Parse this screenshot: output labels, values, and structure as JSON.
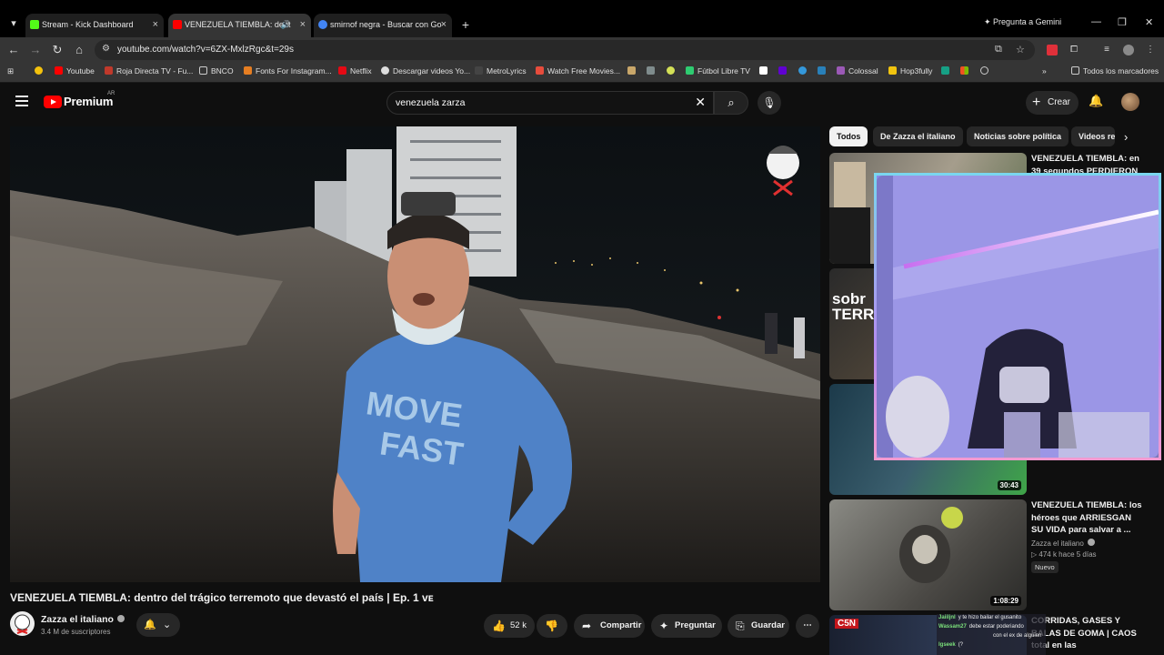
{
  "browser": {
    "tabs": [
      {
        "title": "Stream - Kick Dashboard",
        "favicon_color": "#53fc18"
      },
      {
        "title": "VENEZUELA TIEMBLA: dent",
        "favicon_color": "#ff0000"
      },
      {
        "title": "smirnof negra - Buscar con Go",
        "favicon_color": "#4285f4"
      }
    ],
    "gemini_label": "Pregunta a Gemini",
    "url": "youtube.com/watch?v=6ZX-MxlzRgc&t=29s",
    "bookmarks": [
      {
        "label": "",
        "color": "#f4c20d"
      },
      {
        "label": "Youtube",
        "color": "#ff0000"
      },
      {
        "label": "Roja Directa TV - Fu...",
        "color": "#c0392b"
      },
      {
        "label": "BNCO",
        "color": "#888"
      },
      {
        "label": "Fonts For Instagram...",
        "color": "#e67e22"
      },
      {
        "label": "Netflix",
        "color": "#e50914"
      },
      {
        "label": "Descargar videos Yo...",
        "color": "#ddd"
      },
      {
        "label": "MetroLyrics",
        "color": "#444"
      },
      {
        "label": "Watch Free Movies...",
        "color": "#e74c3c"
      },
      {
        "label": "Fútbol Libre TV",
        "color": "#2ecc71"
      },
      {
        "label": "Colossal",
        "color": "#9b59b6"
      },
      {
        "label": "Hop3fully",
        "color": "#f1c40f"
      }
    ],
    "all_bookmarks": "Todos los marcadores"
  },
  "youtube": {
    "logo_text": "Premium",
    "region": "AR",
    "search_query": "venezuela zarza",
    "create_label": "Crear",
    "video": {
      "title": "VENEZUELA TIEMBLA: dentro del trágico terremoto que devastó el país | Ep. 1 ᴠᴇ",
      "channel": "Zazza el italiano",
      "subscribers": "3.4 M de suscriptores",
      "likes": "52 k",
      "share_label": "Compartir",
      "ask_label": "Preguntar",
      "save_label": "Guardar"
    },
    "chips": [
      "Todos",
      "De Zazza el italiano",
      "Noticias sobre política",
      "Videos re"
    ],
    "related": [
      {
        "title": "VENEZUELA TIEMBLA: en 39 segundos PERDIERON",
        "duration": ""
      },
      {
        "title": "",
        "duration": ""
      },
      {
        "title": "",
        "duration": "30:43"
      },
      {
        "title": "VENEZUELA TIEMBLA: los héroes que ARRIESGAN SU VIDA para salvar a ...",
        "channel": "Zazza el italiano",
        "meta": "▷ 474 k  hace 5 días",
        "badge": "Nuevo",
        "duration": "1:08:29"
      },
      {
        "title": "CORRIDAS, GASES Y BALAS DE GOMA | CAOS total en las",
        "duration": ""
      }
    ],
    "thumb_overlay_text": "sobr TERREM",
    "c5n": "C5N"
  },
  "chat": [
    {
      "user": "Jaiiljnl",
      "msg": "y te hizo bailar el gusanito"
    },
    {
      "user": "Wassam27",
      "msg": "debe estar poderiando"
    },
    {
      "user": "",
      "msg": "con el ex de alguien"
    },
    {
      "user": "lgseek",
      "msg": "(?"
    }
  ]
}
